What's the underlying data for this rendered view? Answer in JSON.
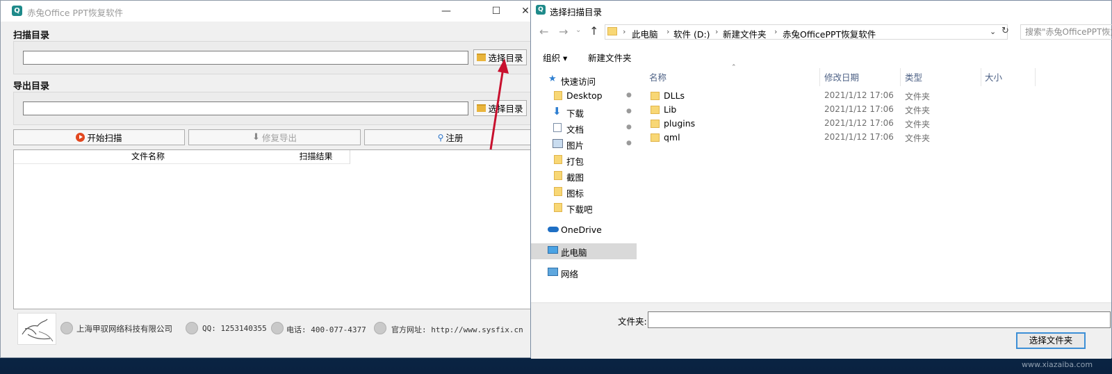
{
  "app": {
    "title": "赤兔Office PPT恢复软件",
    "scan_dir_label": "扫描目录",
    "export_dir_label": "导出目录",
    "scan_dir_value": "",
    "export_dir_value": "",
    "choose_dir_label": "选择目录",
    "start_scan_label": "开始扫描",
    "repair_export_label": "修复导出",
    "register_label": "注册",
    "columns": [
      "文件名称",
      "扫描结果"
    ],
    "footer": {
      "company": "上海甲驭网络科技有限公司",
      "qq": "QQ: 1253140355",
      "phone": "电话: 400-077-4377",
      "website": "官方网址: http://www.sysfix.cn"
    }
  },
  "dialog": {
    "title": "选择扫描目录",
    "breadcrumb": [
      "此电脑",
      "软件 (D:)",
      "新建文件夹",
      "赤兔OfficePPT恢复软件"
    ],
    "search_placeholder": "搜索\"赤兔OfficePPT恢复软件\"",
    "organize_label": "组织 ▾",
    "new_folder_label": "新建文件夹",
    "nav": {
      "quick_access": "快速访问",
      "quick_items": [
        "Desktop",
        "下载",
        "文档",
        "图片",
        "打包",
        "截图",
        "图标",
        "下载吧"
      ],
      "onedrive": "OneDrive",
      "this_pc": "此电脑",
      "network": "网络"
    },
    "columns": {
      "name": "名称",
      "modified": "修改日期",
      "type": "类型",
      "size": "大小"
    },
    "files": [
      {
        "name": "DLLs",
        "modified": "2021/1/12 17:06",
        "type": "文件夹"
      },
      {
        "name": "Lib",
        "modified": "2021/1/12 17:06",
        "type": "文件夹"
      },
      {
        "name": "plugins",
        "modified": "2021/1/12 17:06",
        "type": "文件夹"
      },
      {
        "name": "qml",
        "modified": "2021/1/12 17:06",
        "type": "文件夹"
      }
    ],
    "folder_label": "文件夹:",
    "folder_value": "",
    "select_button": "选择文件夹"
  },
  "watermark": "www.xiazaiba.com",
  "colors": {
    "accent": "#3c8fd6",
    "arrow": "#c8102e",
    "folder": "#f8d775",
    "desktop": "#0b2a55"
  }
}
